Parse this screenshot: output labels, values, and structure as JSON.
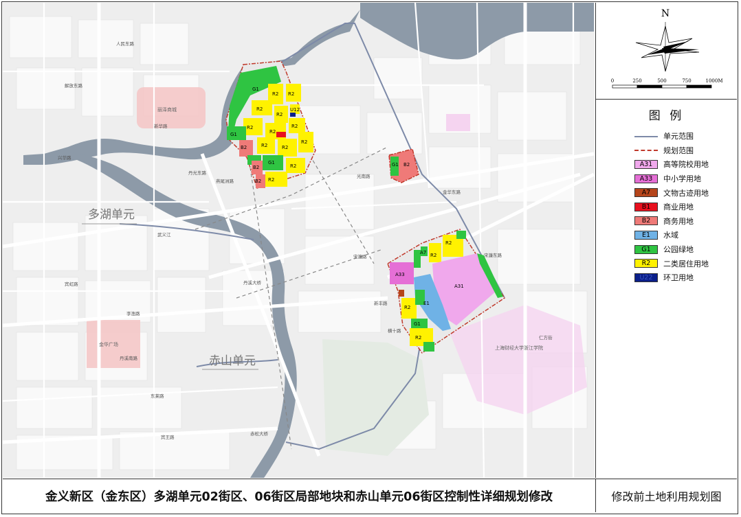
{
  "map": {
    "unit_labels": [
      "多湖单元",
      "赤山单元"
    ],
    "road_labels": [
      "人民东路",
      "解放东路",
      "新华路",
      "兴华路",
      "丹光东路",
      "燕尾洲路",
      "丹溪东路",
      "宾虹路",
      "李渔路",
      "丹溪南路",
      "东市南街",
      "丹溪大桥",
      "赤松大桥",
      "武义江",
      "双龙南街",
      "东莱路",
      "光南路",
      "宋濂路",
      "新丰路",
      "横十路",
      "宾王路",
      "金华东路",
      "滨港大道",
      "仙华路",
      "李渔东路",
      "迎宾大道",
      "东风路",
      "宋濂东路",
      "金东大道",
      "开元街",
      "仁方街"
    ],
    "poi_labels": [
      "上海财经大学浙江学院",
      "金华广场",
      "丽泽商城",
      "万达广场",
      "金东文化广场",
      "东阳江"
    ],
    "block_labels": [
      "G1",
      "R2",
      "B2",
      "B1",
      "A7",
      "E1",
      "A31",
      "A33",
      "U12"
    ]
  },
  "compass": {
    "north": "N",
    "scale_ticks": [
      "0",
      "250",
      "500",
      "750",
      "1000M"
    ]
  },
  "legend": {
    "title": "图 例",
    "items": [
      {
        "kind": "line",
        "color": "#7d8aa8",
        "label": "单元范围"
      },
      {
        "kind": "dash",
        "color": "#c0392b",
        "label": "规划范围"
      },
      {
        "kind": "box",
        "code": "A31",
        "fill": "#f0a8ec",
        "label": "高等院校用地"
      },
      {
        "kind": "box",
        "code": "A33",
        "fill": "#e56fd6",
        "label": "中小学用地"
      },
      {
        "kind": "box",
        "code": "A7",
        "fill": "#b5451b",
        "label": "文物古迹用地"
      },
      {
        "kind": "box",
        "code": "B1",
        "fill": "#e8101e",
        "label": "商业用地"
      },
      {
        "kind": "box",
        "code": "B2",
        "fill": "#ef7a78",
        "label": "商务用地"
      },
      {
        "kind": "box",
        "code": "E1",
        "fill": "#6fb2e6",
        "label": "水域"
      },
      {
        "kind": "box",
        "code": "G1",
        "fill": "#2fc442",
        "label": "公园绿地"
      },
      {
        "kind": "box",
        "code": "R2",
        "fill": "#fff200",
        "label": "二类居住用地"
      },
      {
        "kind": "box",
        "code": "U22",
        "fill": "#0b1f8a",
        "label": "环卫用地"
      }
    ]
  },
  "title": {
    "main": "金义新区（金东区）多湖单元02街区、06街区局部地块和赤山单元06街区控制性详细规划修改",
    "sub": "修改前土地利用规划图"
  },
  "colors": {
    "river": "#8d9aa8",
    "green": "#2fc442",
    "yellow": "#fff200",
    "pink": "#ef7a78",
    "violet": "#e56fd6",
    "water": "#6fb2e6"
  }
}
